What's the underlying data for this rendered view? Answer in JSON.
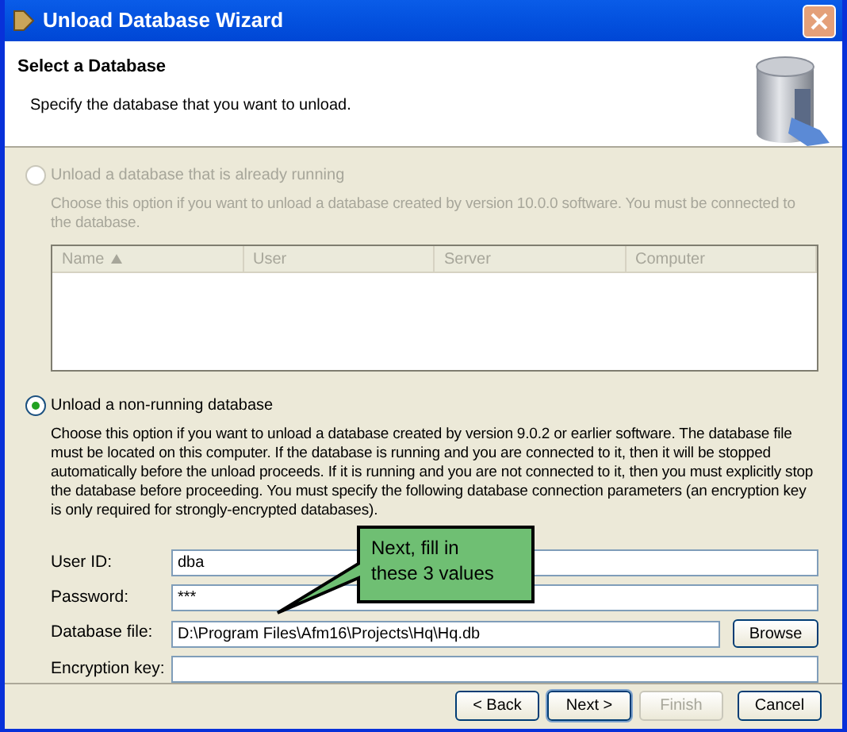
{
  "window": {
    "title": "Unload Database Wizard"
  },
  "header": {
    "title": "Select a Database",
    "subtitle": "Specify the database that you want to unload."
  },
  "options": [
    {
      "label": "Unload a database that is already running",
      "selected": false,
      "disabled": true,
      "description": "Choose this option if you want to unload a database created by version 10.0.0 software. You must be connected to the database.",
      "table": {
        "columns": [
          {
            "label": "Name",
            "sorted": true
          },
          {
            "label": "User",
            "sorted": false
          },
          {
            "label": "Server",
            "sorted": false
          },
          {
            "label": "Computer",
            "sorted": false
          }
        ]
      }
    },
    {
      "label": "Unload a non-running database",
      "selected": true,
      "disabled": false,
      "description": "Choose this option if you want to unload a database created by version 9.0.2 or earlier software. The database file must be located on this computer. If the database is running and you are connected to it, then it will be stopped automatically before the unload proceeds. If it is running and you are not connected to it, then you must explicitly stop the database before proceeding. You must specify the following database connection parameters (an encryption key is only required for strongly-encrypted databases)."
    }
  ],
  "fields": [
    {
      "label": "User ID:",
      "value": "dba"
    },
    {
      "label": "Password:",
      "value": "***"
    },
    {
      "label": "Database file:",
      "value": "D:\\Program Files\\Afm16\\Projects\\Hq\\Hq.db",
      "button": "Browse"
    },
    {
      "label": "Encryption key:"
    }
  ],
  "callout": {
    "lines": [
      "Next, fill in",
      "these 3 values"
    ]
  },
  "buttons": [
    {
      "label": "< Back",
      "disabled": false,
      "default": false
    },
    {
      "label": "Next >",
      "disabled": false,
      "default": true
    },
    {
      "label": "Finish",
      "disabled": true,
      "default": false
    },
    {
      "label": "Cancel",
      "disabled": false,
      "default": false
    }
  ]
}
